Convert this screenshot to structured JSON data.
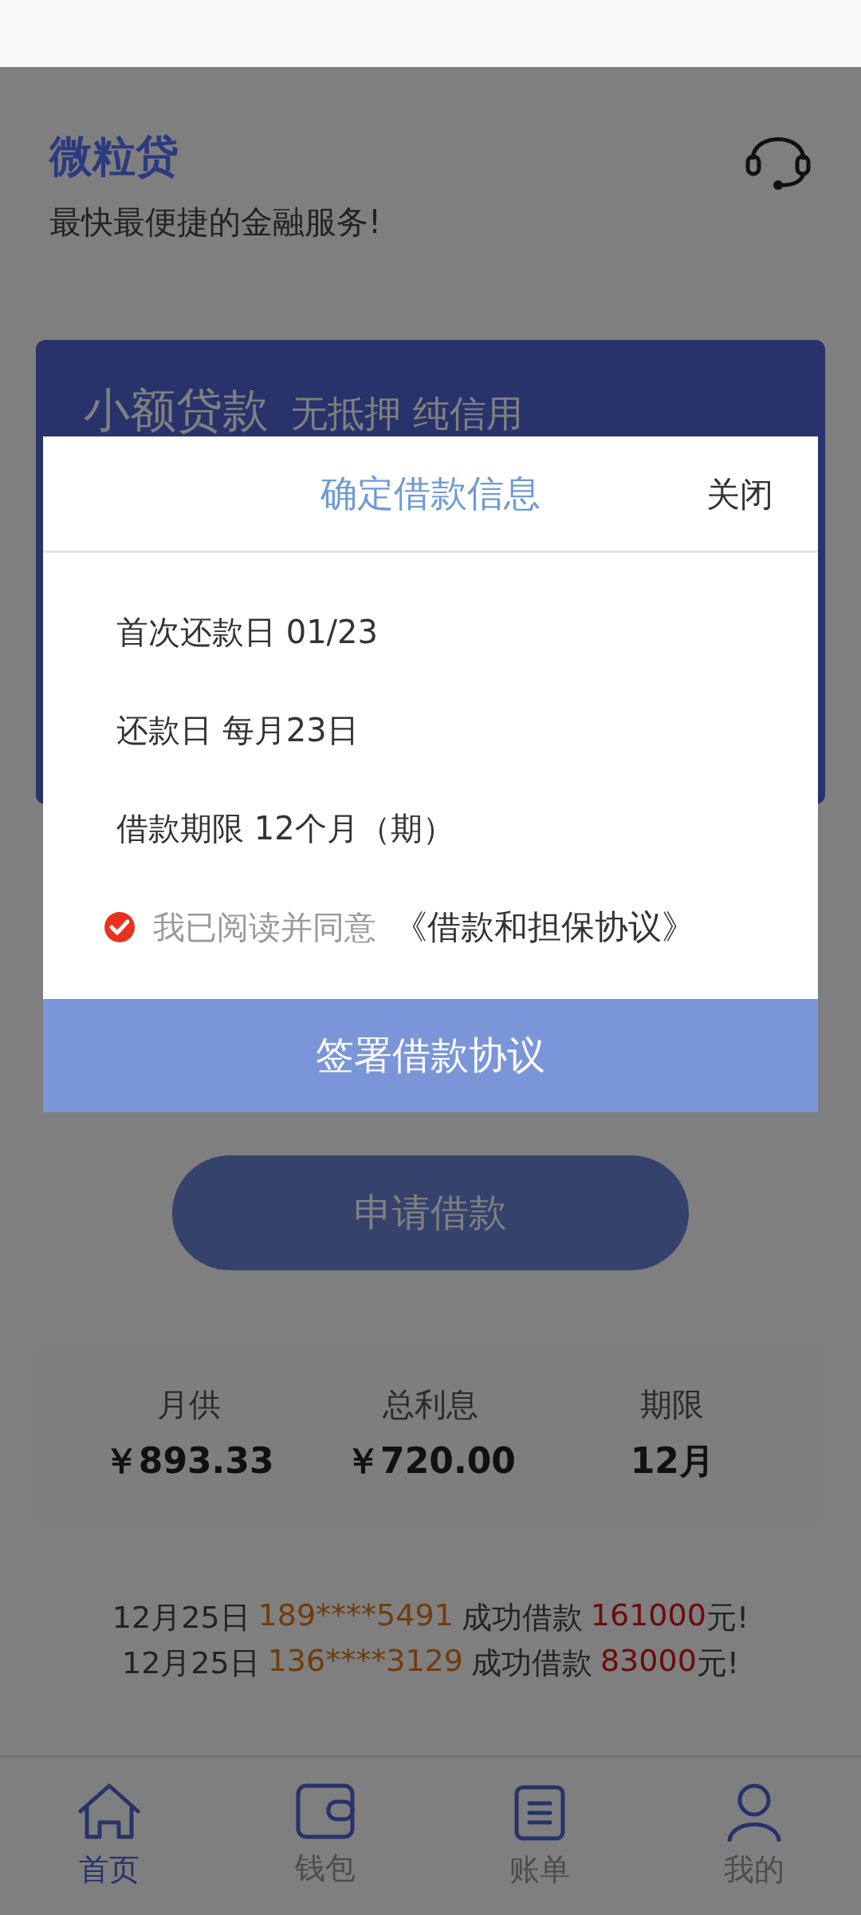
{
  "header": {
    "title": "微粒贷",
    "subtitle": "最快最便捷的金融服务!"
  },
  "card": {
    "title": "小额贷款",
    "tagline": "无抵押 纯信用"
  },
  "apply_button": "申请借款",
  "summary": [
    {
      "label": "月供",
      "value": "￥893.33"
    },
    {
      "label": "总利息",
      "value": "￥720.00"
    },
    {
      "label": "期限",
      "value": "12月"
    }
  ],
  "ticker": [
    {
      "date": "12月25日",
      "phone": "189****5491",
      "action": "成功借款",
      "amount": "161000",
      "unit": "元!"
    },
    {
      "date": "12月25日",
      "phone": "136****3129",
      "action": "成功借款",
      "amount": "83000",
      "unit": "元!"
    }
  ],
  "tabs": [
    {
      "label": "首页",
      "selected": true
    },
    {
      "label": "钱包",
      "selected": false
    },
    {
      "label": "账单",
      "selected": false
    },
    {
      "label": "我的",
      "selected": false
    }
  ],
  "dialog": {
    "title": "确定借款信息",
    "close": "关闭",
    "rows": [
      "首次还款日 01/23",
      "还款日 每月23日",
      "借款期限 12个月（期）"
    ],
    "agreement": {
      "checked": true,
      "text": "我已阅读并同意",
      "link": "《借款和担保协议》"
    },
    "button": "签署借款协议"
  }
}
